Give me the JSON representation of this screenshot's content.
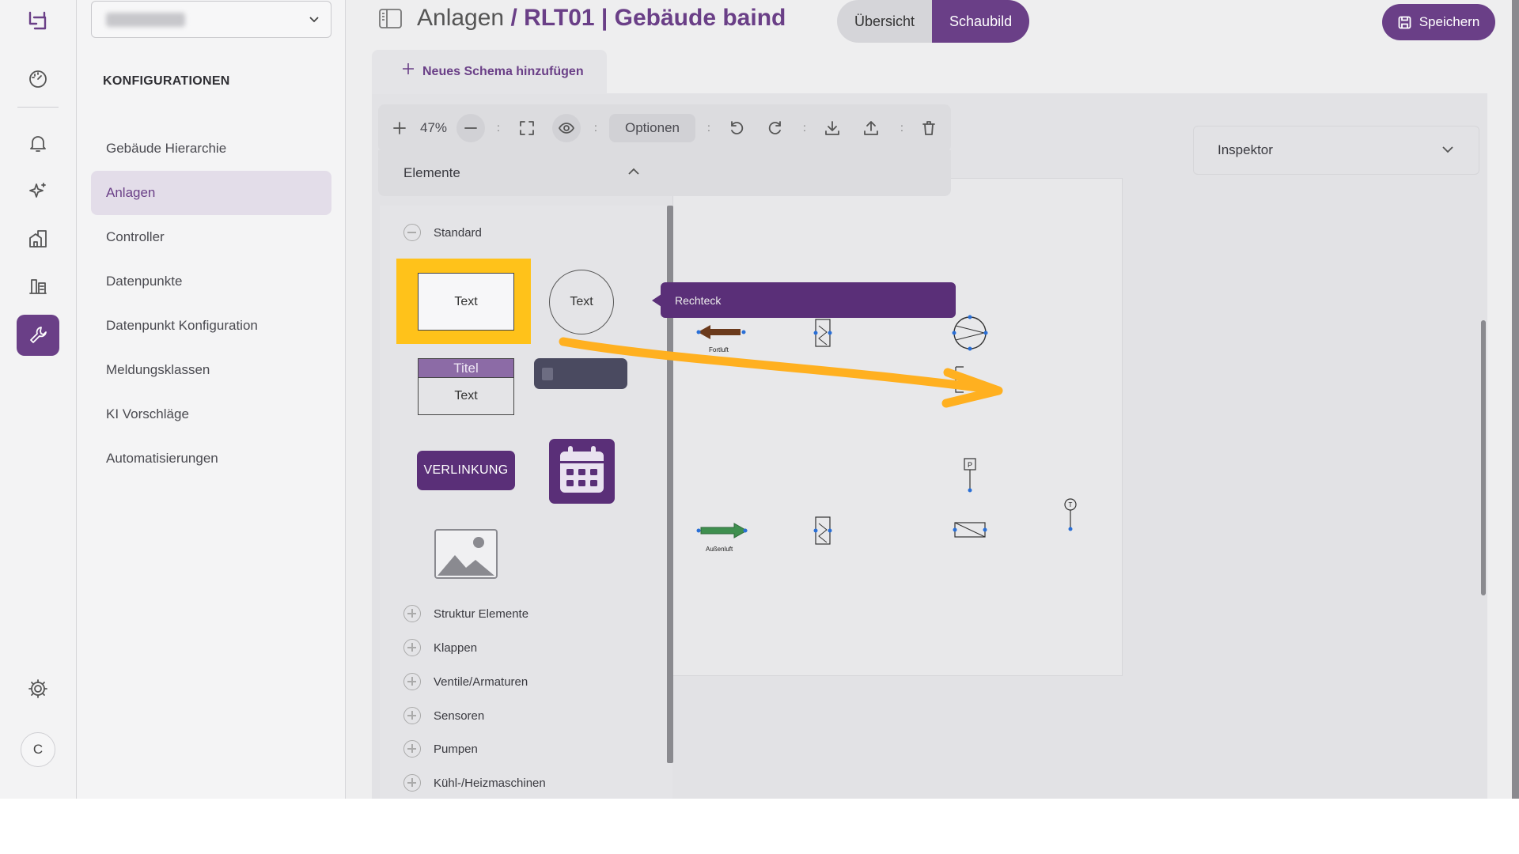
{
  "header": {
    "breadcrumb_parent": "Anlagen",
    "breadcrumb_separator": " / ",
    "breadcrumb_current": "RLT01 | Gebäude baind",
    "view_tabs": [
      {
        "label": "Übersicht",
        "active": false
      },
      {
        "label": "Schaubild",
        "active": true
      }
    ],
    "save_label": "Speichern"
  },
  "rail": {
    "items": [
      "logo-icon",
      "dashboard-icon",
      "bell-icon",
      "sparkle-icon",
      "building-icon",
      "devices-icon",
      "wrench-icon",
      "gear-icon"
    ],
    "active": "wrench-icon",
    "avatar_initial": "C"
  },
  "nav": {
    "heading": "KONFIGURATIONEN",
    "items": [
      {
        "label": "Gebäude Hierarchie",
        "active": false
      },
      {
        "label": "Anlagen",
        "active": true
      },
      {
        "label": "Controller",
        "active": false
      },
      {
        "label": "Datenpunkte",
        "active": false
      },
      {
        "label": "Datenpunkt Konfiguration",
        "active": false
      },
      {
        "label": "Meldungsklassen",
        "active": false
      },
      {
        "label": "KI Vorschläge",
        "active": false
      },
      {
        "label": "Automatisierungen",
        "active": false
      }
    ]
  },
  "schema_tab": {
    "label": "Neues Schema hinzufügen"
  },
  "toolbar": {
    "zoom": "47%",
    "options_label": "Optionen",
    "separator": ":"
  },
  "elements": {
    "header": "Elemente",
    "standard_label": "Standard",
    "items": {
      "rect_text": "Text",
      "circle_text": "Text",
      "card_title": "Titel",
      "card_text": "Text",
      "link_label": "VERLINKUNG"
    },
    "categories": [
      "Struktur Elemente",
      "Klappen",
      "Ventile/Armaturen",
      "Sensoren",
      "Pumpen",
      "Kühl-/Heizmaschinen"
    ]
  },
  "tooltip": {
    "text": "Rechteck"
  },
  "inspector": {
    "label": "Inspektor"
  },
  "canvas": {
    "labels": {
      "fortluft": "Fortluft",
      "aussenluft": "Außenluft",
      "sensor_p": "P",
      "sensor_t": "T"
    }
  },
  "colors": {
    "accent": "#6a3f87",
    "highlight": "#ffc21a",
    "annotation_arrow": "#ffb020",
    "fortluft_arrow": "#6b3a1c",
    "aussenluft_arrow": "#3f8f4f"
  }
}
